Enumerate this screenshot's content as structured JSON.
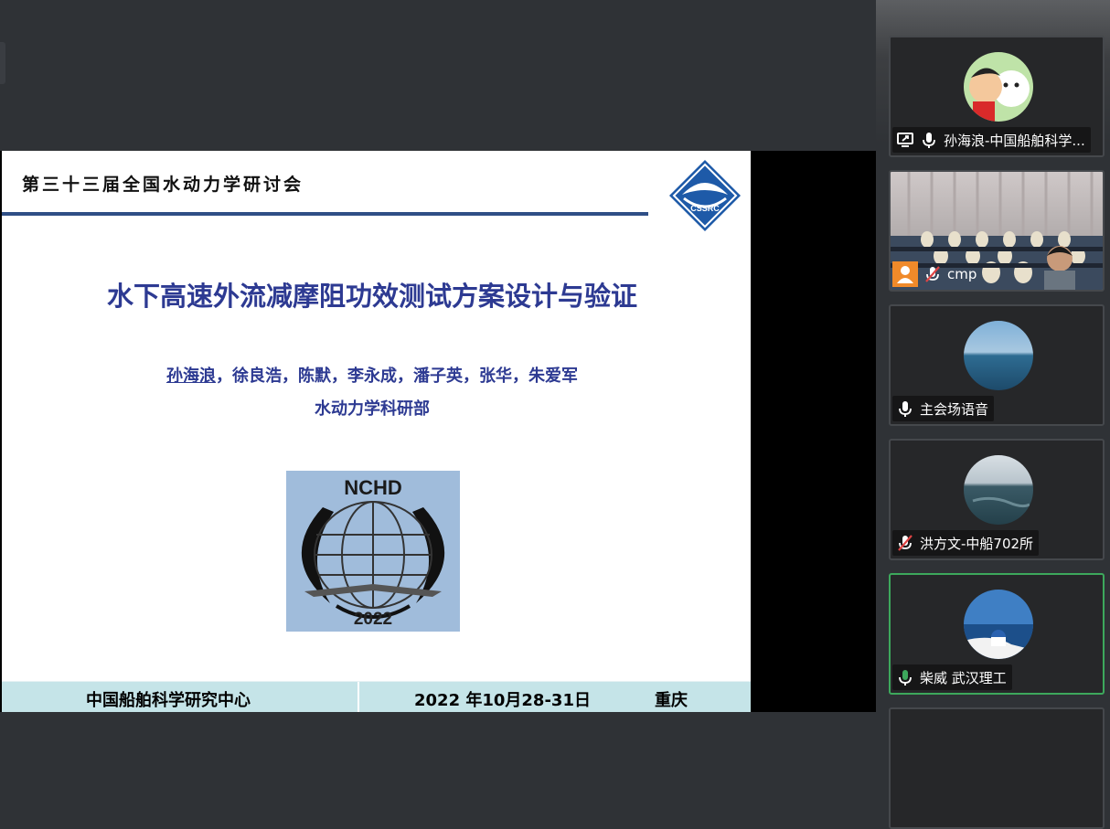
{
  "slide": {
    "conference_title": "第三十三届全国水动力学研讨会",
    "cssrc_logo_text": "CSSRC",
    "main_title": "水下高速外流减摩阻功效测试方案设计与验证",
    "authors_first": "孙海浪",
    "authors_rest": "，徐良浩，陈默，李永成，潘子英，张华，朱爱军",
    "department": "水动力学科研部",
    "nchd_text": "NCHD",
    "nchd_year": "2022",
    "footer_org": "中国船舶科学研究中心",
    "footer_date": "2022 年10月28-31日",
    "footer_city": "重庆"
  },
  "participants": [
    {
      "name": "孙海浪-中国船舶科学...",
      "mic": "on",
      "sharing": true
    },
    {
      "name": "cmp",
      "mic": "muted",
      "video": true
    },
    {
      "name": "主会场语音",
      "mic": "on"
    },
    {
      "name": "洪方文-中船702所",
      "mic": "muted"
    },
    {
      "name": "柴威 武汉理工",
      "mic": "active"
    }
  ],
  "colors": {
    "slide_title": "#2d3a92",
    "header_line": "#2f4f86",
    "footer_bg": "#c5e4e8",
    "active_speaker": "#3da85c",
    "muted_mic": "#e04444"
  }
}
